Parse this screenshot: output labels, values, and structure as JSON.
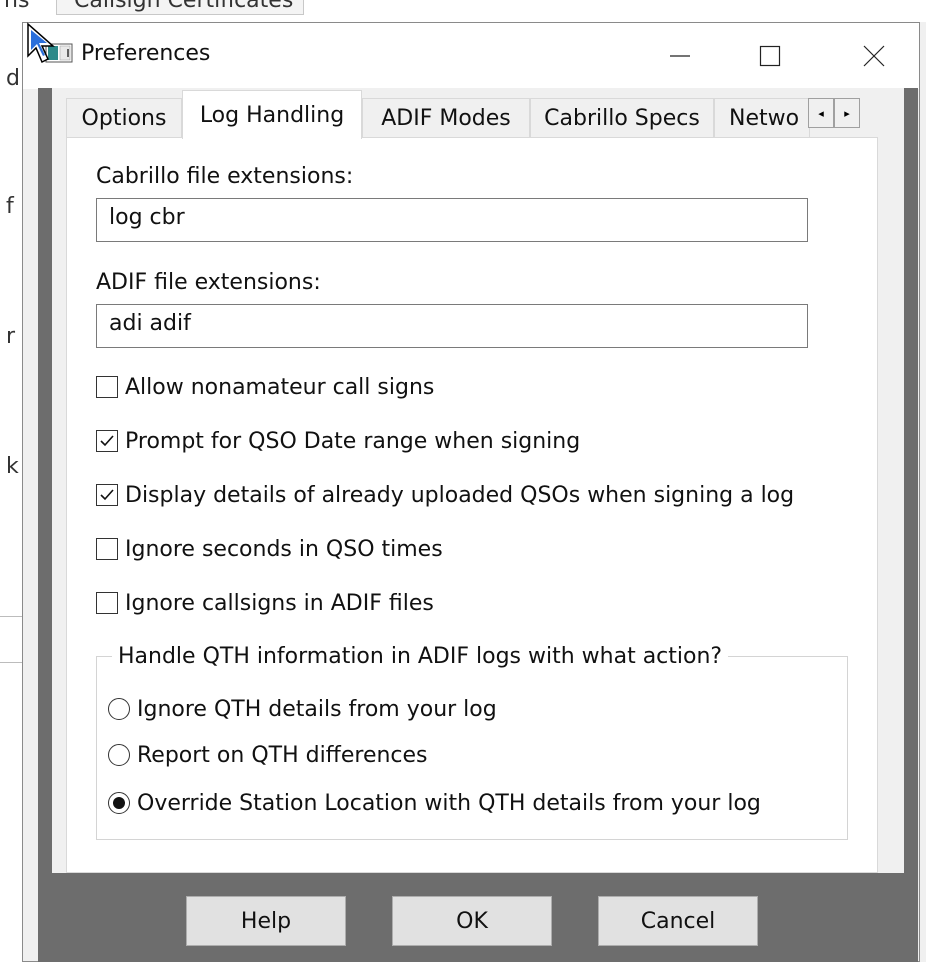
{
  "window": {
    "title": "Preferences"
  },
  "tabs": [
    {
      "label": "Options",
      "active": false
    },
    {
      "label": "Log Handling",
      "active": true
    },
    {
      "label": "ADIF Modes",
      "active": false
    },
    {
      "label": "Cabrillo Specs",
      "active": false
    },
    {
      "label": "Netwo",
      "active": false
    }
  ],
  "tab_scroll": {
    "left": "◂",
    "right": "▸"
  },
  "fields": {
    "cabrillo": {
      "label": "Cabrillo file extensions:",
      "value": "log cbr"
    },
    "adif": {
      "label": "ADIF file extensions:",
      "value": "adi adif"
    }
  },
  "checkboxes": [
    {
      "label": "Allow nonamateur call signs",
      "checked": false
    },
    {
      "label": "Prompt for QSO Date range when signing",
      "checked": true
    },
    {
      "label": "Display details of already uploaded QSOs when signing a log",
      "checked": true
    },
    {
      "label": "Ignore seconds in QSO times",
      "checked": false
    },
    {
      "label": "Ignore callsigns in ADIF files",
      "checked": false
    }
  ],
  "qth_group": {
    "legend": "Handle QTH information in ADIF logs with what action?",
    "options": [
      {
        "label": "Ignore QTH details from your log",
        "selected": false
      },
      {
        "label": "Report on QTH differences",
        "selected": false
      },
      {
        "label": "Override Station Location with QTH details from your log",
        "selected": true
      }
    ]
  },
  "buttons": {
    "help": "Help",
    "ok": "OK",
    "cancel": "Cancel"
  },
  "background": {
    "top_text": "Callsign Certificates",
    "top_left_text": "ns",
    "left_glyphs": [
      "d",
      "f",
      "r",
      "k"
    ]
  },
  "colors": {
    "dialog_bg": "#f0f0f0",
    "page_bg": "#ffffff",
    "border": "#7a7a7a"
  }
}
